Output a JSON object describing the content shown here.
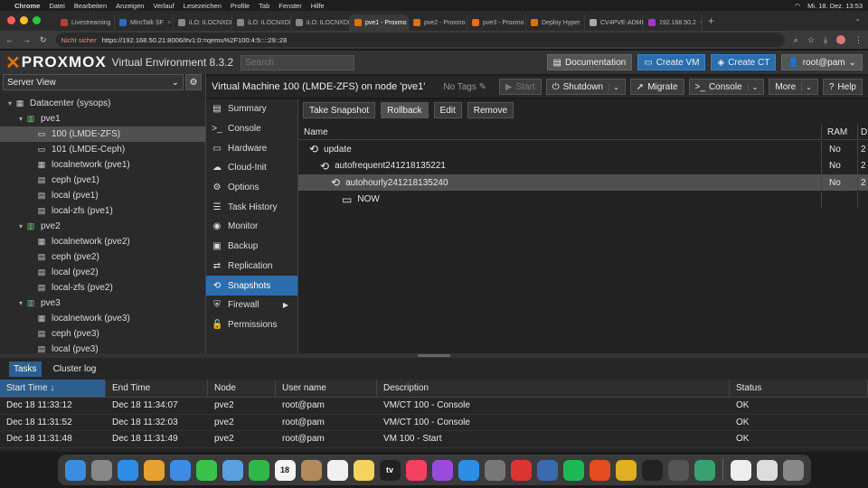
{
  "menubar": {
    "app": "Chrome",
    "items": [
      "Datei",
      "Bearbeiten",
      "Anzeigen",
      "Verlauf",
      "Lesezeichen",
      "Profile",
      "Tab",
      "Fenster",
      "Hilfe"
    ],
    "clock": "Mi. 18. Dez.  13:53"
  },
  "browser_tabs": [
    {
      "label": "Livestreaming",
      "color": "#c33"
    },
    {
      "label": "MiroTalk SF",
      "color": "#36c"
    },
    {
      "label": "iLO: ILOCNXDI",
      "color": "#888"
    },
    {
      "label": "iLO: ILOCNXDI",
      "color": "#888"
    },
    {
      "label": "iLO: ILOCNXDI",
      "color": "#888"
    },
    {
      "label": "pve1 - Proxmo",
      "color": "#e57000",
      "active": true
    },
    {
      "label": "pve2 - Proxmo",
      "color": "#e57000"
    },
    {
      "label": "pve3 - Proxmo",
      "color": "#e57000"
    },
    {
      "label": "Deploy Hyper",
      "color": "#e57000"
    },
    {
      "label": "CV4PVE-ADMI",
      "color": "#aaa"
    },
    {
      "label": "192.168.50.2",
      "color": "#a3c"
    }
  ],
  "address": {
    "warning": "Nicht sicher",
    "url": "https://192.168.50.21:8006/#v1:0:=qemu%2F100:4:5::::29::28"
  },
  "header": {
    "brand": "PROXMOX",
    "product": "Virtual Environment 8.3.2",
    "search_placeholder": "Search",
    "documentation": "Documentation",
    "create_vm": "Create VM",
    "create_ct": "Create CT",
    "user": "root@pam"
  },
  "left": {
    "view": "Server View"
  },
  "tree": [
    {
      "label": "Datacenter (sysops)",
      "level": 0,
      "icon": "datacenter-icon",
      "arrow": "▾"
    },
    {
      "label": "pve1",
      "level": 1,
      "icon": "node-icon",
      "arrow": "▾"
    },
    {
      "label": "100 (LMDE-ZFS)",
      "level": 2,
      "icon": "vm-running-icon",
      "selected": true
    },
    {
      "label": "101 (LMDE-Ceph)",
      "level": 2,
      "icon": "vm-running-icon"
    },
    {
      "label": "localnetwork (pve1)",
      "level": 2,
      "icon": "network-icon"
    },
    {
      "label": "ceph (pve1)",
      "level": 2,
      "icon": "storage-icon"
    },
    {
      "label": "local (pve1)",
      "level": 2,
      "icon": "storage-icon"
    },
    {
      "label": "local-zfs (pve1)",
      "level": 2,
      "icon": "storage-icon"
    },
    {
      "label": "pve2",
      "level": 1,
      "icon": "node-icon",
      "arrow": "▾"
    },
    {
      "label": "localnetwork (pve2)",
      "level": 2,
      "icon": "network-icon"
    },
    {
      "label": "ceph (pve2)",
      "level": 2,
      "icon": "storage-icon"
    },
    {
      "label": "local (pve2)",
      "level": 2,
      "icon": "storage-icon"
    },
    {
      "label": "local-zfs (pve2)",
      "level": 2,
      "icon": "storage-icon"
    },
    {
      "label": "pve3",
      "level": 1,
      "icon": "node-icon",
      "arrow": "▾"
    },
    {
      "label": "localnetwork (pve3)",
      "level": 2,
      "icon": "network-icon"
    },
    {
      "label": "ceph (pve3)",
      "level": 2,
      "icon": "storage-icon"
    },
    {
      "label": "local (pve3)",
      "level": 2,
      "icon": "storage-icon"
    }
  ],
  "vm": {
    "title": "Virtual Machine 100 (LMDE-ZFS) on node 'pve1'",
    "tags": "No Tags",
    "start": "Start",
    "shutdown": "Shutdown",
    "migrate": "Migrate",
    "console": "Console",
    "more": "More",
    "help": "Help"
  },
  "nav": [
    {
      "label": "Summary",
      "icon": "summary-icon",
      "glyph": "▤"
    },
    {
      "label": "Console",
      "icon": "console-icon",
      "glyph": ">_"
    },
    {
      "label": "Hardware",
      "icon": "hardware-icon",
      "glyph": "▭"
    },
    {
      "label": "Cloud-Init",
      "icon": "cloud-icon",
      "glyph": "☁"
    },
    {
      "label": "Options",
      "icon": "gear-icon",
      "glyph": "⚙"
    },
    {
      "label": "Task History",
      "icon": "list-icon",
      "glyph": "☰"
    },
    {
      "label": "Monitor",
      "icon": "eye-icon",
      "glyph": "◉"
    },
    {
      "label": "Backup",
      "icon": "floppy-icon",
      "glyph": "▣"
    },
    {
      "label": "Replication",
      "icon": "retweet-icon",
      "glyph": "⇄"
    },
    {
      "label": "Snapshots",
      "icon": "history-icon",
      "glyph": "⟲",
      "selected": true
    },
    {
      "label": "Firewall",
      "icon": "shield-icon",
      "glyph": "⛨",
      "arrow": "▶"
    },
    {
      "label": "Permissions",
      "icon": "unlock-icon",
      "glyph": "🔓"
    }
  ],
  "snap_toolbar": {
    "take": "Take Snapshot",
    "rollback": "Rollback",
    "edit": "Edit",
    "remove": "Remove"
  },
  "snap_cols": {
    "name": "Name",
    "ram": "RAM",
    "date": "D"
  },
  "snapshots": [
    {
      "name": "update",
      "ram": "No",
      "date": "2"
    },
    {
      "name": "autofrequent241218135221",
      "ram": "No",
      "date": "2"
    },
    {
      "name": "autohourly241218135240",
      "ram": "No",
      "date": "2",
      "selected": true
    },
    {
      "name": "NOW",
      "ram": "",
      "date": ""
    }
  ],
  "bottom_tabs": {
    "tasks": "Tasks",
    "cluster": "Cluster log"
  },
  "task_cols": {
    "start": "Start Time",
    "end": "End Time",
    "node": "Node",
    "user": "User name",
    "desc": "Description",
    "status": "Status"
  },
  "tasks": [
    {
      "start": "Dec 18 11:33:12",
      "end": "Dec 18 11:34:07",
      "node": "pve2",
      "user": "root@pam",
      "desc": "VM/CT 100 - Console",
      "status": "OK"
    },
    {
      "start": "Dec 18 11:31:52",
      "end": "Dec 18 11:32:03",
      "node": "pve2",
      "user": "root@pam",
      "desc": "VM/CT 100 - Console",
      "status": "OK"
    },
    {
      "start": "Dec 18 11:31:48",
      "end": "Dec 18 11:31:49",
      "node": "pve2",
      "user": "root@pam",
      "desc": "VM 100 - Start",
      "status": "OK"
    }
  ],
  "dock": [
    {
      "name": "finder-icon",
      "color": "#3b8de0"
    },
    {
      "name": "launchpad-icon",
      "color": "#888"
    },
    {
      "name": "safari-icon",
      "color": "#2d8ee6"
    },
    {
      "name": "photos-icon",
      "color": "#e8a030"
    },
    {
      "name": "mail-icon",
      "color": "#3d8be6"
    },
    {
      "name": "messages-icon",
      "color": "#3ac24a"
    },
    {
      "name": "maps-icon",
      "color": "#5aa0e0"
    },
    {
      "name": "facetime-icon",
      "color": "#2fb84a"
    },
    {
      "name": "calendar-icon",
      "color": "#f4f4f4",
      "text": "18",
      "textcolor": "#222"
    },
    {
      "name": "contacts-icon",
      "color": "#b08a5a"
    },
    {
      "name": "reminders-icon",
      "color": "#f0f0f0"
    },
    {
      "name": "notes-icon",
      "color": "#f3d35a"
    },
    {
      "name": "tv-icon",
      "color": "#222",
      "text": "tv"
    },
    {
      "name": "music-icon",
      "color": "#f3425f"
    },
    {
      "name": "podcasts-icon",
      "color": "#9a4bdc"
    },
    {
      "name": "appstore-icon",
      "color": "#2d8ee6"
    },
    {
      "name": "settings-icon",
      "color": "#777"
    },
    {
      "name": "anydesk-icon",
      "color": "#d33"
    },
    {
      "name": "network-radar-icon",
      "color": "#3a6ab0"
    },
    {
      "name": "spotify-icon",
      "color": "#1db954"
    },
    {
      "name": "brave-icon",
      "color": "#e44c21"
    },
    {
      "name": "chrome-icon",
      "color": "#e0b020"
    },
    {
      "name": "terminal-icon",
      "color": "#222"
    },
    {
      "name": "calculator-icon",
      "color": "#555"
    },
    {
      "name": "sync-icon",
      "color": "#3aa070"
    },
    {
      "name": "document-icon",
      "color": "#eee"
    },
    {
      "name": "preview-icon",
      "color": "#ddd"
    },
    {
      "name": "trash-icon",
      "color": "#888"
    }
  ]
}
